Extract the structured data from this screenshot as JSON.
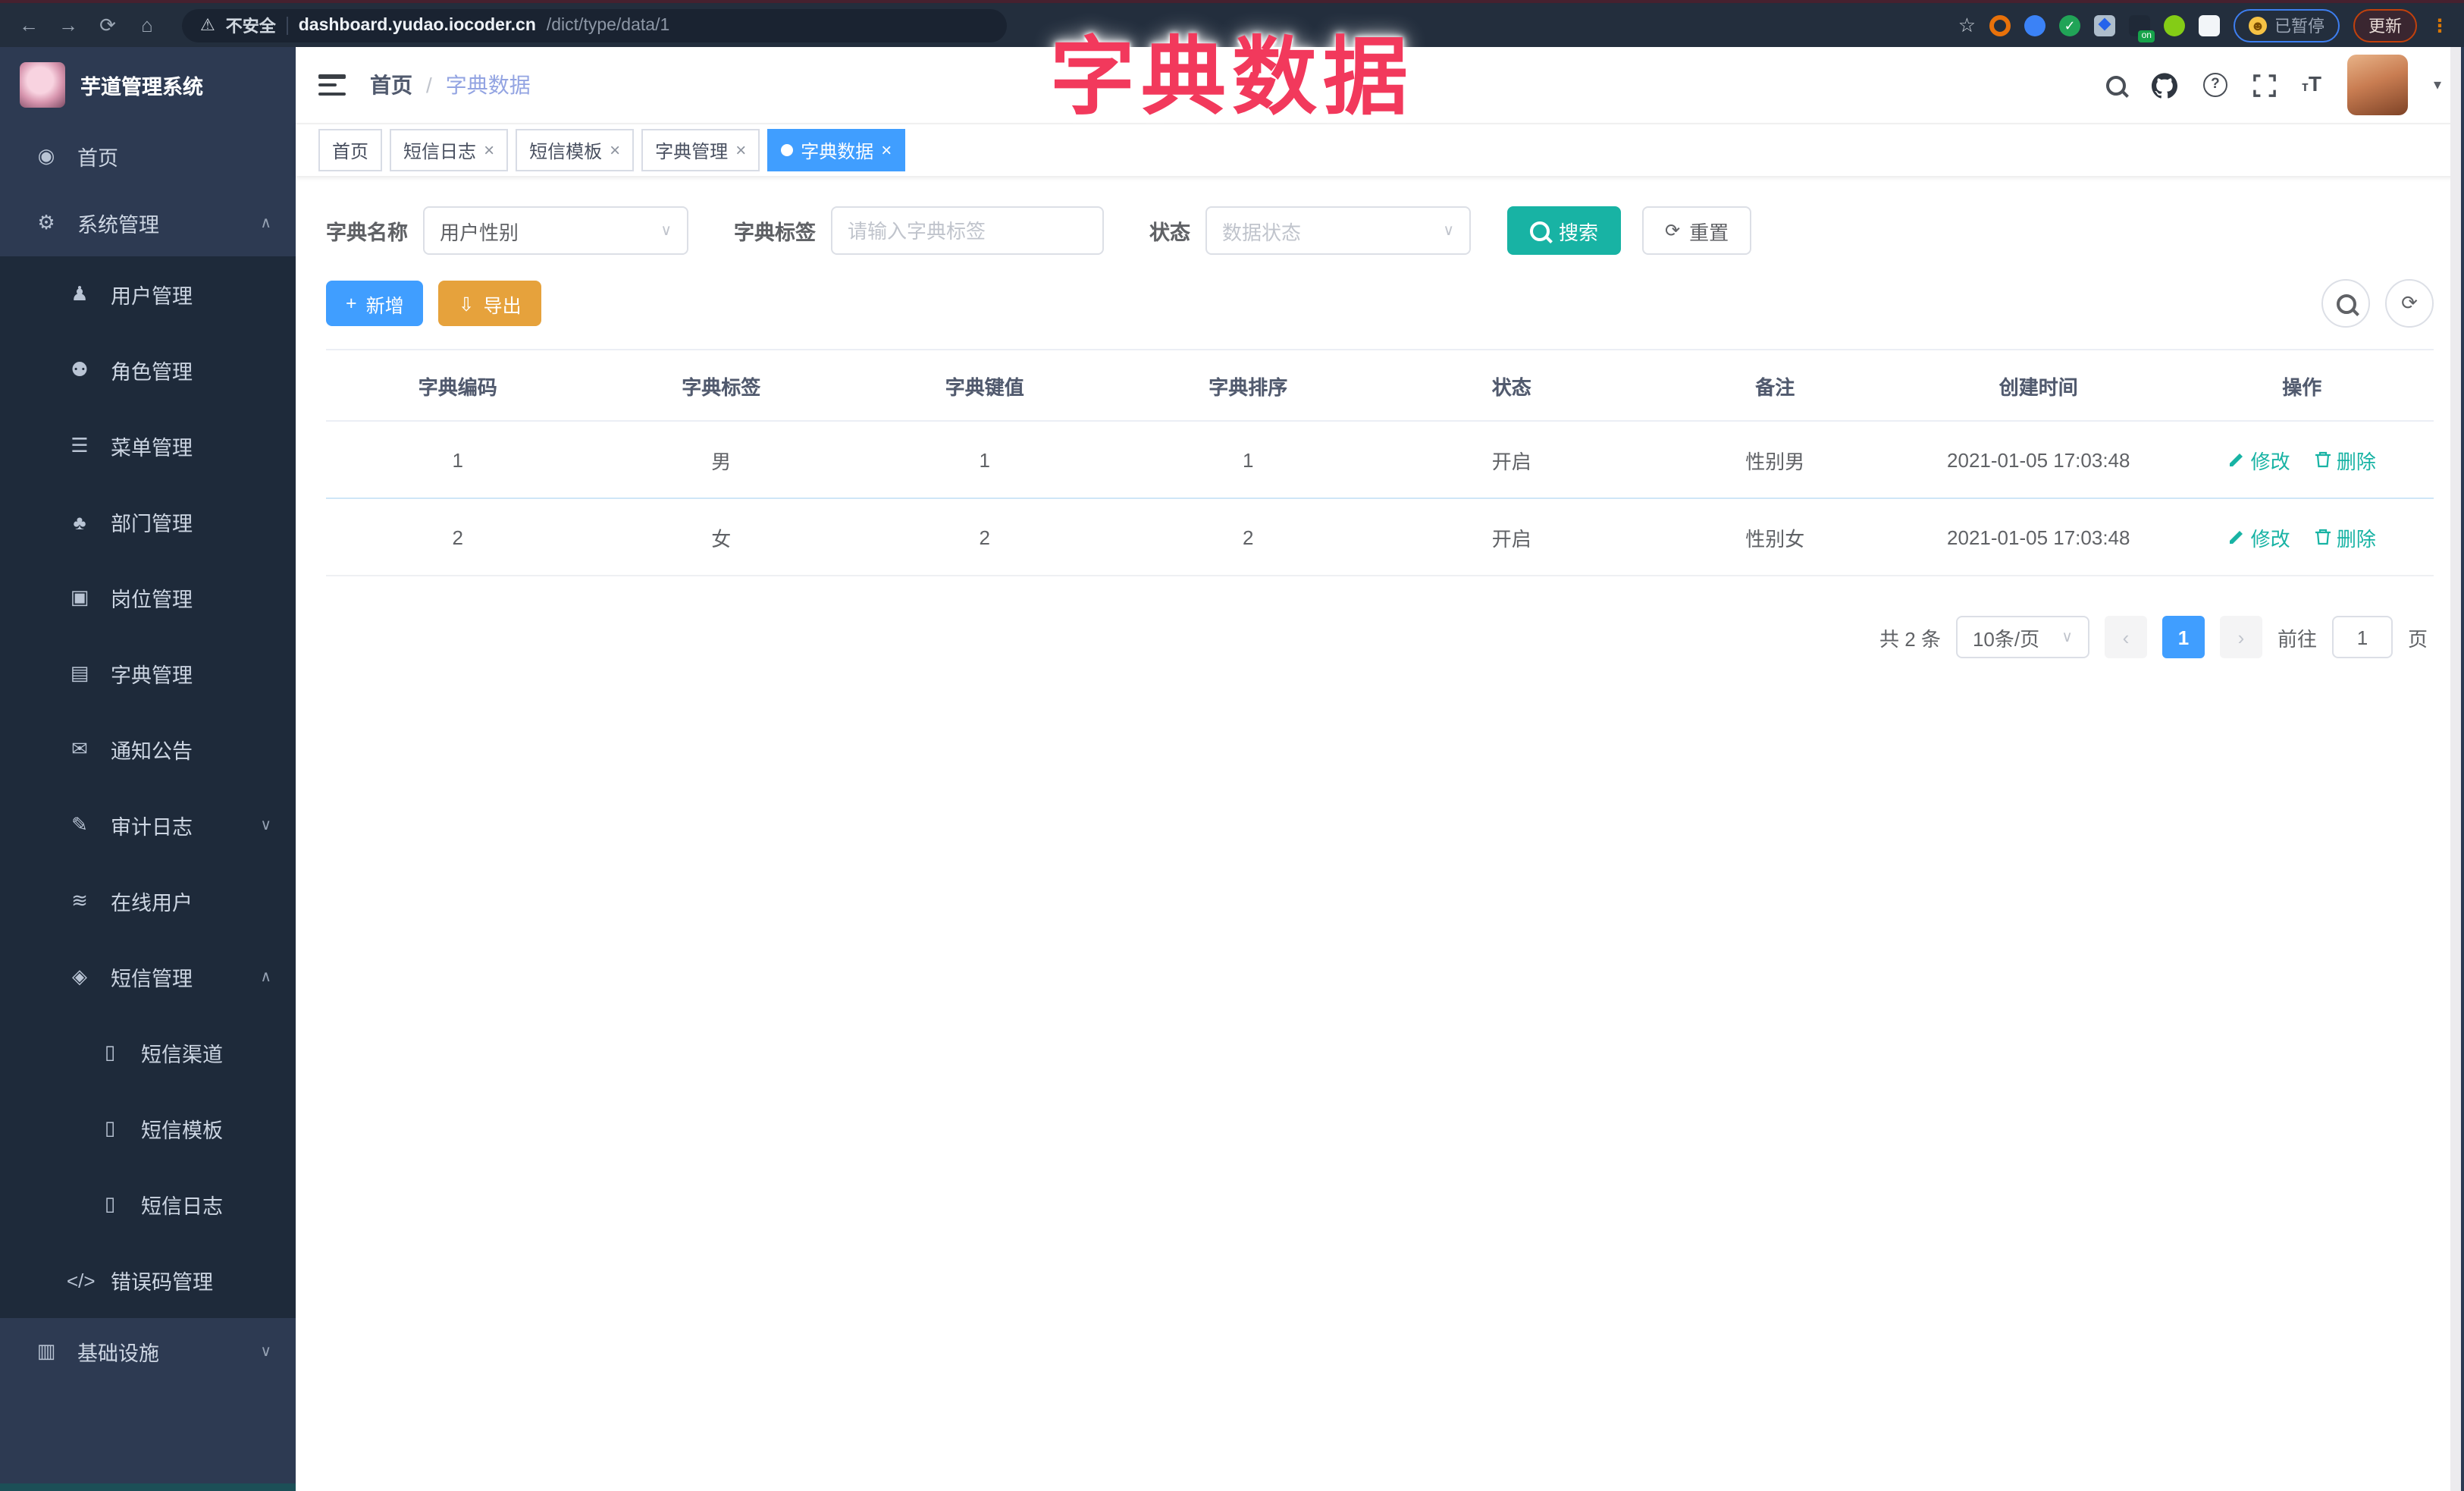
{
  "browser": {
    "back_glyph": "←",
    "forward_glyph": "→",
    "reload_glyph": "⟳",
    "home_glyph": "⌂",
    "warning_glyph": "⚠",
    "security_label": "不安全",
    "url_host": "dashboard.yudao.iocoder.cn",
    "url_path": "/dict/type/data/1",
    "star_glyph": "☆",
    "ext_on_label": "on",
    "paused_emoji": "☻",
    "paused_label": "已暂停",
    "update_label": "更新",
    "menu_dots_glyph": "⋮"
  },
  "overlay_title": "字典数据",
  "sidebar": {
    "logo_title": "芋道管理系统",
    "items": [
      {
        "label": "首页",
        "glyph": "◉"
      },
      {
        "label": "系统管理",
        "glyph": "⚙",
        "chevron": "∧"
      },
      {
        "label": "用户管理",
        "glyph": "♟"
      },
      {
        "label": "角色管理",
        "glyph": "⚉"
      },
      {
        "label": "菜单管理",
        "glyph": "☰"
      },
      {
        "label": "部门管理",
        "glyph": "♣"
      },
      {
        "label": "岗位管理",
        "glyph": "▣"
      },
      {
        "label": "字典管理",
        "glyph": "▤"
      },
      {
        "label": "通知公告",
        "glyph": "✉"
      },
      {
        "label": "审计日志",
        "glyph": "✎",
        "chevron": "∨"
      },
      {
        "label": "在线用户",
        "glyph": "≋"
      },
      {
        "label": "短信管理",
        "glyph": "◈",
        "chevron": "∧"
      },
      {
        "label": "短信渠道",
        "glyph": "▯"
      },
      {
        "label": "短信模板",
        "glyph": "▯"
      },
      {
        "label": "短信日志",
        "glyph": "▯"
      },
      {
        "label": "错误码管理",
        "glyph": "</>"
      },
      {
        "label": "基础设施",
        "glyph": "▥",
        "chevron": "∨"
      }
    ]
  },
  "navbar": {
    "breadcrumb_home": "首页",
    "breadcrumb_sep": "/",
    "breadcrumb_current": "字典数据",
    "help_glyph": "?",
    "font_icon_small": "т",
    "font_icon_big": "T",
    "caret_glyph": "▾"
  },
  "tabs": {
    "close_glyph": "×",
    "items": [
      {
        "label": "首页"
      },
      {
        "label": "短信日志"
      },
      {
        "label": "短信模板"
      },
      {
        "label": "字典管理"
      },
      {
        "label": "字典数据"
      }
    ]
  },
  "filters": {
    "dict_name_label": "字典名称",
    "dict_name_value": "用户性别",
    "dict_label_label": "字典标签",
    "dict_label_placeholder": "请输入字典标签",
    "status_label": "状态",
    "status_placeholder": "数据状态",
    "search_button": "搜索",
    "reset_button": "重置",
    "reset_glyph": "⟳",
    "caret_glyph": "∨"
  },
  "toolbar": {
    "add_button": "新增",
    "add_glyph": "+",
    "export_button": "导出",
    "export_glyph": "⇩",
    "refresh_glyph": "⟳"
  },
  "table": {
    "headers": [
      "字典编码",
      "字典标签",
      "字典键值",
      "字典排序",
      "状态",
      "备注",
      "创建时间",
      "操作"
    ],
    "rows": [
      {
        "code": "1",
        "label": "男",
        "value": "1",
        "sort": "1",
        "status": "开启",
        "remark": "性别男",
        "created": "2021-01-05 17:03:48"
      },
      {
        "code": "2",
        "label": "女",
        "value": "2",
        "sort": "2",
        "status": "开启",
        "remark": "性别女",
        "created": "2021-01-05 17:03:48"
      }
    ],
    "edit_label": "修改",
    "delete_label": "删除"
  },
  "pagination": {
    "total": "共 2 条",
    "page_size": "10条/页",
    "prev_glyph": "‹",
    "next_glyph": "›",
    "current_page": "1",
    "goto_label": "前往",
    "goto_value": "1",
    "page_unit": "页"
  },
  "theme": {
    "primary": "#409eff",
    "search_teal": "#18b3a4",
    "export_orange": "#e6a23c",
    "overlay_pink": "#f2395c",
    "sidebar_bg": "#2d3a52",
    "submenu_bg": "#1e2a3a"
  }
}
